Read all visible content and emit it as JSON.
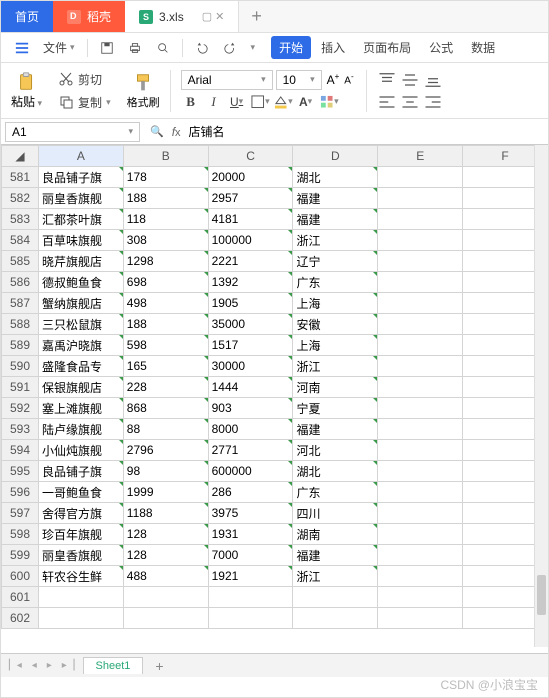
{
  "tabs": {
    "home": "首页",
    "dao": "稻壳",
    "file": "3.xls",
    "winctl": "▢ ✕"
  },
  "menubar": {
    "file": "文件",
    "start": "开始",
    "insert": "插入",
    "layout": "页面布局",
    "formula": "公式",
    "data": "数据"
  },
  "ribbon": {
    "paste": "粘贴",
    "cut": "剪切",
    "copy": "复制",
    "fmtpaint": "格式刷",
    "font": "Arial",
    "size": "10",
    "B": "B",
    "I": "I",
    "U": "U",
    "Aplus": "A",
    "Aminus": "A"
  },
  "namebox": "A1",
  "fx": "店铺名",
  "cols": [
    "A",
    "B",
    "C",
    "D",
    "E",
    "F"
  ],
  "rows": [
    {
      "n": 581,
      "a": "良品铺子旗",
      "b": "178",
      "c": "20000",
      "d": "湖北"
    },
    {
      "n": 582,
      "a": "丽皇香旗舰",
      "b": "188",
      "c": "2957",
      "d": "福建"
    },
    {
      "n": 583,
      "a": "汇都茶叶旗",
      "b": "118",
      "c": "4181",
      "d": "福建"
    },
    {
      "n": 584,
      "a": "百草味旗舰",
      "b": "308",
      "c": "100000",
      "d": "浙江"
    },
    {
      "n": 585,
      "a": "晓芹旗舰店",
      "b": "1298",
      "c": "2221",
      "d": "辽宁"
    },
    {
      "n": 586,
      "a": "德叔鲍鱼食",
      "b": "698",
      "c": "1392",
      "d": "广东"
    },
    {
      "n": 587,
      "a": "蟹纳旗舰店",
      "b": "498",
      "c": "1905",
      "d": "上海"
    },
    {
      "n": 588,
      "a": "三只松鼠旗",
      "b": "188",
      "c": "35000",
      "d": "安徽"
    },
    {
      "n": 589,
      "a": "嘉禹沪晓旗",
      "b": "598",
      "c": "1517",
      "d": "上海"
    },
    {
      "n": 590,
      "a": "盛隆食品专",
      "b": "165",
      "c": "30000",
      "d": "浙江"
    },
    {
      "n": 591,
      "a": "保银旗舰店",
      "b": "228",
      "c": "1444",
      "d": "河南"
    },
    {
      "n": 592,
      "a": "塞上滩旗舰",
      "b": "868",
      "c": "903",
      "d": "宁夏"
    },
    {
      "n": 593,
      "a": "陆卢缘旗舰",
      "b": "88",
      "c": "8000",
      "d": "福建"
    },
    {
      "n": 594,
      "a": "小仙炖旗舰",
      "b": "2796",
      "c": "2771",
      "d": "河北"
    },
    {
      "n": 595,
      "a": "良品铺子旗",
      "b": "98",
      "c": "600000",
      "d": "湖北"
    },
    {
      "n": 596,
      "a": "一哥鲍鱼食",
      "b": "1999",
      "c": "286",
      "d": "广东"
    },
    {
      "n": 597,
      "a": "舍得官方旗",
      "b": "1188",
      "c": "3975",
      "d": "四川"
    },
    {
      "n": 598,
      "a": "珍百年旗舰",
      "b": "128",
      "c": "1931",
      "d": "湖南"
    },
    {
      "n": 599,
      "a": "丽皇香旗舰",
      "b": "128",
      "c": "7000",
      "d": "福建"
    },
    {
      "n": 600,
      "a": "轩农谷生鲜",
      "b": "488",
      "c": "1921",
      "d": "浙江"
    },
    {
      "n": 601,
      "a": "",
      "b": "",
      "c": "",
      "d": ""
    },
    {
      "n": 602,
      "a": "",
      "b": "",
      "c": "",
      "d": ""
    }
  ],
  "sheettab": "Sheet1",
  "watermark": "CSDN @小浪宝宝"
}
